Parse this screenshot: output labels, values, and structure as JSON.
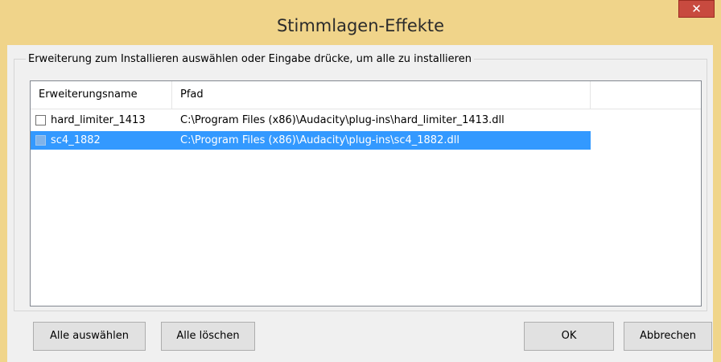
{
  "window": {
    "title": "Stimmlagen-Effekte",
    "close_glyph": "✕"
  },
  "group": {
    "label": "Erweiterung zum Installieren auswählen oder Eingabe drücke, um alle zu installieren"
  },
  "list": {
    "columns": [
      "Erweiterungsname",
      "Pfad"
    ],
    "rows": [
      {
        "name": "hard_limiter_1413",
        "path": "C:\\Program Files (x86)\\Audacity\\plug-ins\\hard_limiter_1413.dll",
        "checked": false,
        "selected": false
      },
      {
        "name": "sc4_1882",
        "path": "C:\\Program Files (x86)\\Audacity\\plug-ins\\sc4_1882.dll",
        "checked": false,
        "selected": true
      }
    ]
  },
  "buttons": {
    "select_all": "Alle auswählen",
    "clear_all": "Alle löschen",
    "ok": "OK",
    "cancel": "Abbrechen"
  },
  "colors": {
    "title_bg": "#f0d48a",
    "selection": "#3399ff",
    "close_bg": "#c84a3f"
  }
}
